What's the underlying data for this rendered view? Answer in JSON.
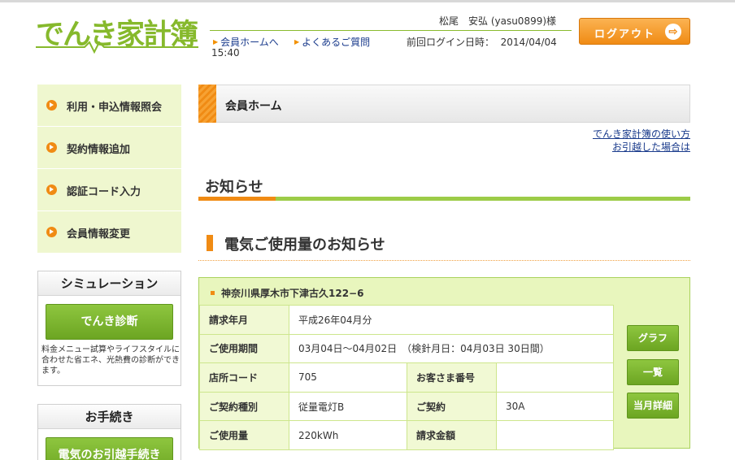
{
  "header": {
    "logo_text": "でんき家計簿",
    "user_name": "松尾　安弘 (yasu0899)様",
    "nav": [
      {
        "label": "会員ホームへ"
      },
      {
        "label": "よくあるご質問"
      }
    ],
    "last_login_label": "前回ログイン日時：",
    "last_login_date": "2014/04/04",
    "last_login_time": "15:40",
    "logout_label": "ログアウト",
    "logout_arrow": "⇨"
  },
  "sidebar": {
    "items": [
      {
        "label": "利用・申込情報照会"
      },
      {
        "label": "契約情報追加"
      },
      {
        "label": "認証コード入力"
      },
      {
        "label": "会員情報変更"
      }
    ],
    "simulation": {
      "title": "シミュレーション",
      "button": "でんき診断",
      "description": "料金メニュー試算やライフスタイルに合わせた省エネ、光熱費の診断ができます。"
    },
    "procedures": {
      "title": "お手続き",
      "button": "電気のお引越手続き"
    }
  },
  "main": {
    "page_title": "会員ホーム",
    "links": [
      {
        "label": "でんき家計簿の使い方"
      },
      {
        "label": "お引越した場合は"
      }
    ],
    "section_title": "お知らせ",
    "notice_title": "電気ご使用量のお知らせ",
    "notice": {
      "address": "神奈川県厚木市下津古久122−6",
      "billing_month_label": "請求年月",
      "billing_month": "平成26年04月分",
      "period_label": "ご使用期間",
      "period": "03月04日〜04月02日　（検針月日：04月03日 30日間）",
      "shop_code_label": "店所コード",
      "shop_code": "705",
      "customer_no_label": "お客さま番号",
      "customer_no": "",
      "contract_type_label": "ご契約種別",
      "contract_type": "従量電灯B",
      "contract_label": "ご契約",
      "contract": "30A",
      "usage_label": "ご使用量",
      "usage": "220kWh",
      "amount_label": "請求金額",
      "amount": ""
    },
    "buttons": {
      "graph": "グラフ",
      "list": "一覧",
      "detail": "当月詳細"
    }
  },
  "colors": {
    "brand_green": "#86b92c",
    "accent_orange": "#f08b14",
    "link_blue": "#1a3b8c"
  }
}
